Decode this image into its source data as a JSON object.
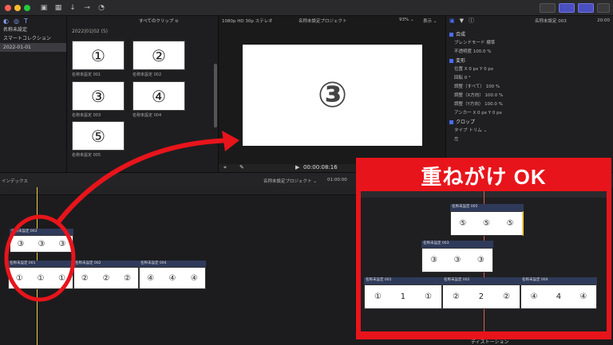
{
  "toolbar": {
    "colors": {
      "close": "#ff5f57",
      "min": "#febc2e",
      "max": "#28c840",
      "accent": "#4b4fbf"
    }
  },
  "library": {
    "items": [
      {
        "label": "名称未設定"
      },
      {
        "label": "スマートコレクション"
      },
      {
        "label": "2022-01-01"
      }
    ]
  },
  "browser": {
    "filter_label": "すべてのクリップ ≎",
    "group_header": "2022|01|02  (5)",
    "clips": [
      {
        "symbol": "①",
        "label": "名称未設定 001"
      },
      {
        "symbol": "②",
        "label": "名称未設定 002"
      },
      {
        "symbol": "③",
        "label": "名称未設定 003"
      },
      {
        "symbol": "④",
        "label": "名称未設定 004"
      },
      {
        "symbol": "⑤",
        "label": "名称未設定 005"
      }
    ]
  },
  "viewer": {
    "format_label": "1080p HD 30p ステレオ",
    "project_label": "名称未設定プロジェクト",
    "zoom_label": "93% ⌄",
    "display_label": "表示 ⌄",
    "frame_symbol": "③",
    "timecode": "00:00:08:16"
  },
  "inspector": {
    "title": "名称未設定 003",
    "timecode": "20:00",
    "sections": [
      {
        "label": "合成",
        "rows": [
          "ブレンドモード   標準",
          "不透明度   100.0 %"
        ]
      },
      {
        "label": "変形",
        "rows": [
          "位置   X 0 px   Y 0 px",
          "回転   0 °",
          "調整（すべて）   100 %",
          "調整（X方向）   100.0 %",
          "調整（Y方向）   100.0 %",
          "アンカー   X 0 px   Y 0 px"
        ]
      },
      {
        "label": "クロップ",
        "rows": [
          "タイプ   トリム ⌄",
          "左"
        ]
      }
    ]
  },
  "timeline": {
    "index_label": "インデックス",
    "project_label": "名称未設定プロジェクト ⌄",
    "duration_label": "01:00:00",
    "upper_clip": {
      "label": "名称未設定 003",
      "symbol": "③"
    },
    "lower_clips": [
      {
        "label": "名称未設定 001",
        "symbol": "①"
      },
      {
        "label": "名称未設定 002",
        "symbol": "②"
      },
      {
        "label": "名称未設定 004",
        "symbol": "④"
      }
    ]
  },
  "callout": {
    "title": "重ねがけ OK",
    "top_clip": {
      "label": "名称未設定 005",
      "symbol": "⑤",
      "center_symbol": "⑤"
    },
    "mid_clip": {
      "label": "名称未設定 003",
      "symbol": "③",
      "center_symbol": "③"
    },
    "bottom_clips": [
      {
        "label": "名称未設定 001",
        "symbol": "①",
        "center_symbol": "1"
      },
      {
        "label": "名称未設定 002",
        "symbol": "②",
        "center_symbol": "2"
      },
      {
        "label": "名称未設定 004",
        "symbol": "④",
        "center_symbol": "4"
      }
    ],
    "footer_label": "ディストーション",
    "color": "#e8141b"
  }
}
